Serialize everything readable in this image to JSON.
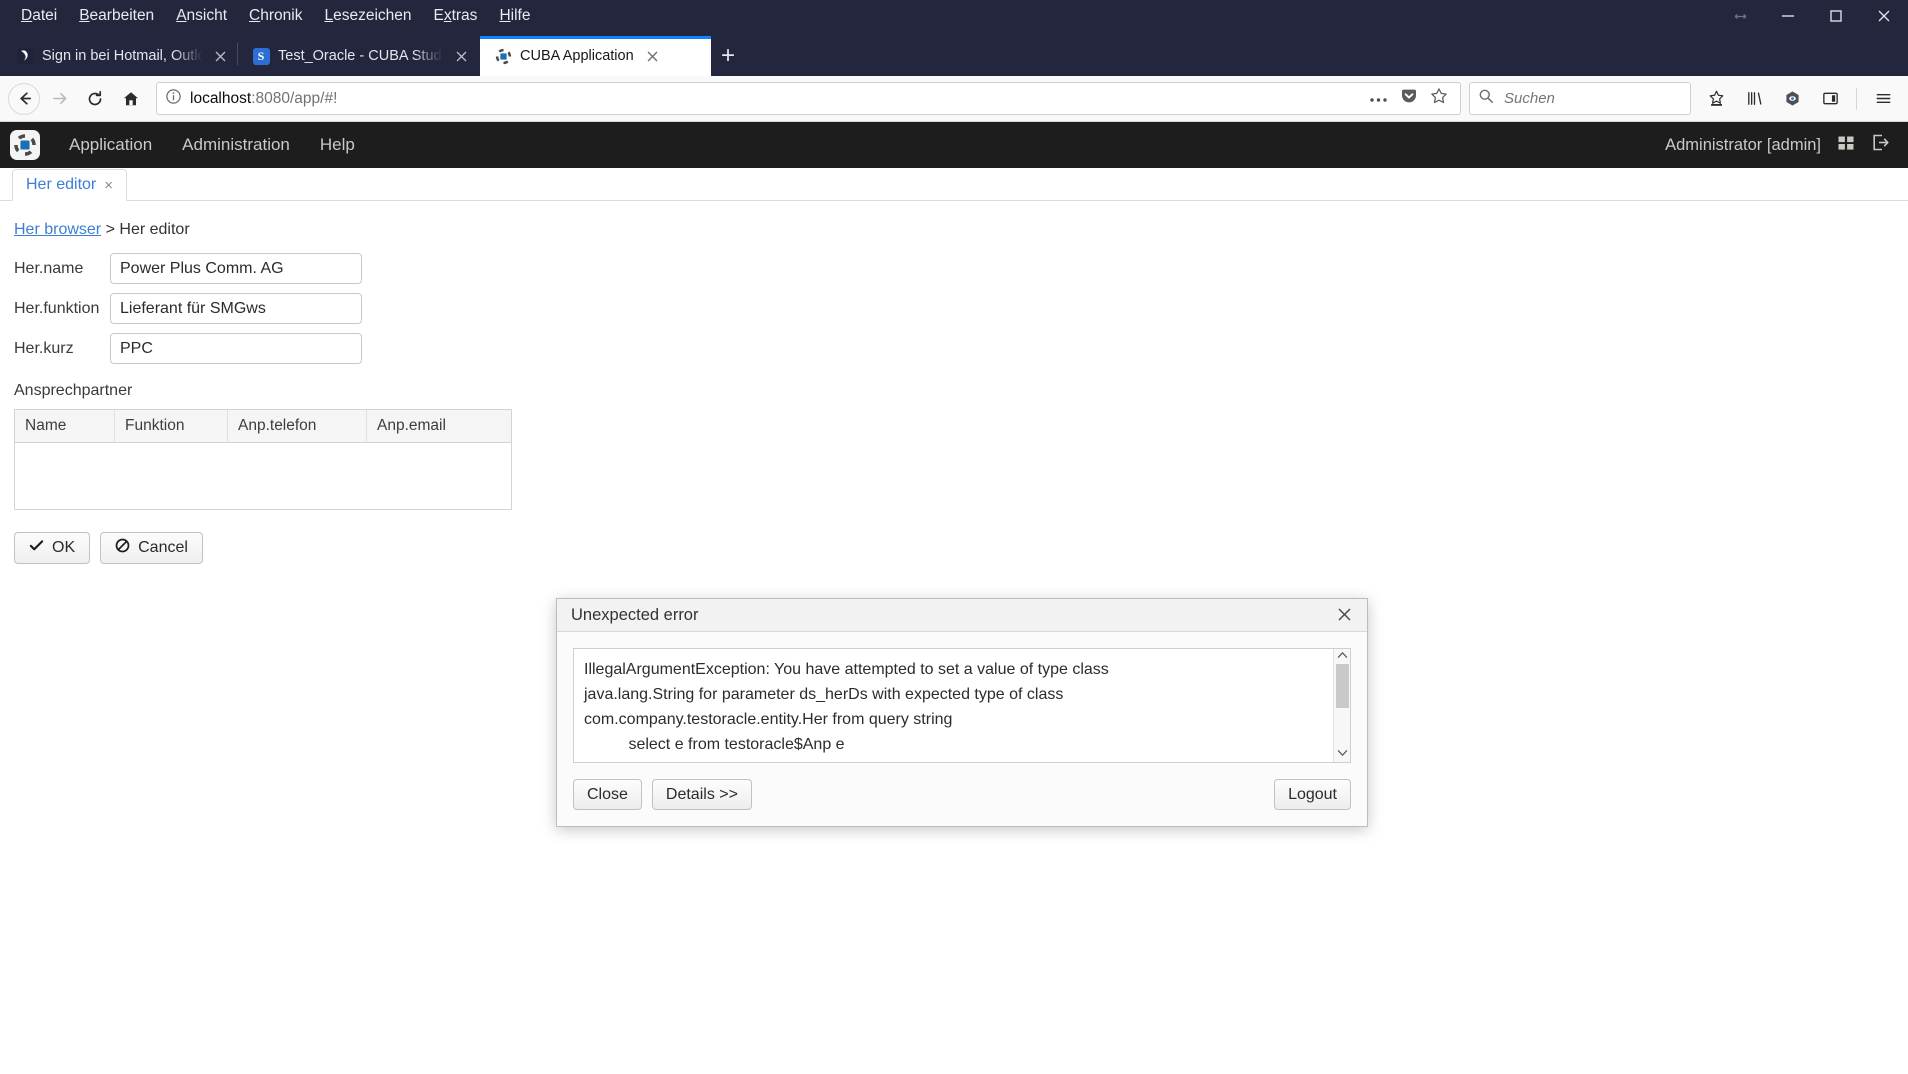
{
  "window": {
    "menus": [
      {
        "label": "Datei",
        "accel": "D"
      },
      {
        "label": "Bearbeiten",
        "accel": "B"
      },
      {
        "label": "Ansicht",
        "accel": "A"
      },
      {
        "label": "Chronik",
        "accel": "C"
      },
      {
        "label": "Lesezeichen",
        "accel": "L"
      },
      {
        "label": "Extras",
        "accel": "x"
      },
      {
        "label": "Hilfe",
        "accel": "H"
      }
    ],
    "controls": {
      "minimize": "minimize-icon",
      "maximize": "maximize-icon",
      "close": "close-icon"
    }
  },
  "tabs": [
    {
      "title": "Sign in bei Hotmail, Outlook Lo",
      "favicon": "outlook-icon",
      "active": false
    },
    {
      "title": "Test_Oracle - CUBA Studio",
      "favicon": "cuba-studio-icon",
      "active": false
    },
    {
      "title": "CUBA Application",
      "favicon": "cuba-app-icon",
      "active": true
    }
  ],
  "newtab_label": "+",
  "navbar": {
    "back": "back-arrow-icon",
    "forward": "forward-arrow-icon",
    "reload": "reload-icon",
    "home": "home-icon",
    "url_host": "localhost",
    "url_path": ":8080/app/#!",
    "page_actions": "ellipsis-icon",
    "pocket": "pocket-icon",
    "bookmark": "star-icon",
    "search_placeholder": "Suchen",
    "tools": [
      "save-to-pocket-icon",
      "library-icon",
      "container-eye-icon",
      "sidebar-icon",
      "hamburger-menu-icon"
    ]
  },
  "app": {
    "logo": "cuba-logo-icon",
    "menu": [
      "Application",
      "Administration",
      "Help"
    ],
    "user": "Administrator [admin]",
    "apps_icon": "grid-apps-icon",
    "logout_icon": "logout-icon",
    "screen_tab": {
      "label": "Her editor",
      "close": "×"
    },
    "breadcrumb": {
      "link": "Her browser",
      "separator": ">",
      "current": "Her editor"
    },
    "form": [
      {
        "label": "Her.name",
        "value": "Power Plus Comm. AG"
      },
      {
        "label": "Her.funktion",
        "value": "Lieferant für SMGws"
      },
      {
        "label": "Her.kurz",
        "value": "PPC"
      }
    ],
    "table": {
      "title": "Ansprechpartner",
      "columns": [
        "Name",
        "Funktion",
        "Anp.telefon",
        "Anp.email"
      ],
      "rows": []
    },
    "buttons": [
      {
        "label": "OK",
        "icon": "check-icon"
      },
      {
        "label": "Cancel",
        "icon": "ban-icon"
      }
    ]
  },
  "dialog": {
    "title": "Unexpected error",
    "close_icon": "close-icon",
    "message": "IllegalArgumentException: You have attempted to set a value of type class\njava.lang.String for parameter ds_herDs with expected type of class\ncom.company.testoracle.entity.Her from query string\n          select e from testoracle$Anp e\n      where e.herKurz = :ds_herDs",
    "buttons": {
      "close": "Close",
      "details": "Details >>",
      "logout": "Logout"
    },
    "scrollbar": {
      "up": "⌃",
      "down": "⌄"
    }
  }
}
